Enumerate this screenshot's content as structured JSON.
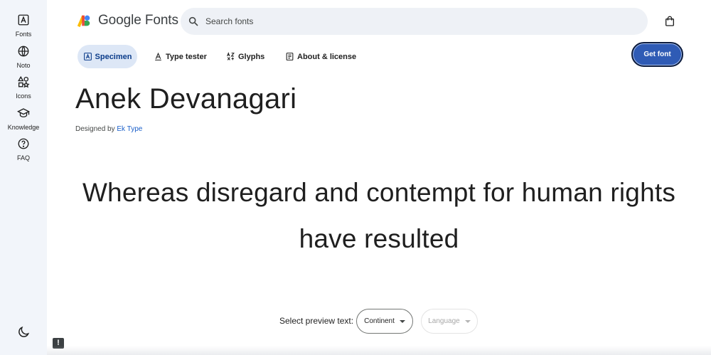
{
  "rail": {
    "items": [
      {
        "label": "Fonts",
        "icon": "font-icon"
      },
      {
        "label": "Noto",
        "icon": "globe-icon"
      },
      {
        "label": "Icons",
        "icon": "shapes-icon"
      },
      {
        "label": "Knowledge",
        "icon": "graduation-cap-icon"
      },
      {
        "label": "FAQ",
        "icon": "help-circle-icon"
      }
    ],
    "theme_icon": "dark-mode-moon-icon"
  },
  "header": {
    "logo_text": "Google Fonts",
    "search_placeholder": "Search fonts",
    "bag_icon": "shopping-bag-icon"
  },
  "tabs": [
    {
      "label": "Specimen",
      "icon": "font-box-icon",
      "active": true
    },
    {
      "label": "Type tester",
      "icon": "text-cursor-icon",
      "active": false
    },
    {
      "label": "Glyphs",
      "icon": "glyphs-icon",
      "active": false
    },
    {
      "label": "About & license",
      "icon": "article-icon",
      "active": false
    }
  ],
  "get_font_label": "Get font",
  "font": {
    "name": "Anek Devanagari",
    "designed_by_prefix": "Designed by",
    "designer": "Ek Type"
  },
  "specimen": {
    "line1": "Whereas disregard and contempt for human rights",
    "line2": "have resulted"
  },
  "preview": {
    "label": "Select preview text:",
    "continent_value": "Continent",
    "language_value": "Language"
  },
  "feedback_glyph": "!",
  "colors": {
    "accent": "#2f5bb5",
    "tab_active_bg": "#dde7f6",
    "link": "#1a5fc9",
    "rail_bg": "#f2f5fa",
    "search_bg": "#eef1f6"
  }
}
